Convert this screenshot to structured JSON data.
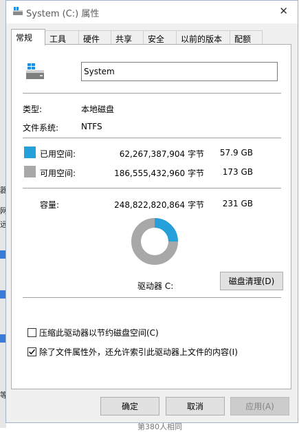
{
  "window": {
    "title": "System (C:) 属性"
  },
  "tabs": [
    {
      "label": "常规"
    },
    {
      "label": "工具"
    },
    {
      "label": "硬件"
    },
    {
      "label": "共享"
    },
    {
      "label": "安全"
    },
    {
      "label": "以前的版本"
    },
    {
      "label": "配额"
    }
  ],
  "drive_name": "System",
  "type_label": "类型:",
  "type_value": "本地磁盘",
  "fs_label": "文件系统:",
  "fs_value": "NTFS",
  "used": {
    "label": "已用空间:",
    "bytes": "62,267,387,904 字节",
    "size": "57.9 GB",
    "color": "#26a0da",
    "fraction": 0.25
  },
  "free": {
    "label": "可用空间:",
    "bytes": "186,555,432,960 字节",
    "size": "173 GB",
    "color": "#a8a8a8"
  },
  "capacity": {
    "label": "容量:",
    "bytes": "248,822,820,864 字节",
    "size": "231 GB"
  },
  "drive_label": "驱动器 C:",
  "cleanup_button": "磁盘清理(D)",
  "options": {
    "compress": {
      "label": "压缩此驱动器以节约磁盘空间(C)",
      "checked": false
    },
    "index": {
      "label": "除了文件属性外，还允许索引此驱动器上文件的内容(I)",
      "checked": true
    }
  },
  "buttons": {
    "ok": "确定",
    "cancel": "取消",
    "apply": "应用(A)"
  },
  "background": {
    "footer_text": "第380人相同"
  }
}
